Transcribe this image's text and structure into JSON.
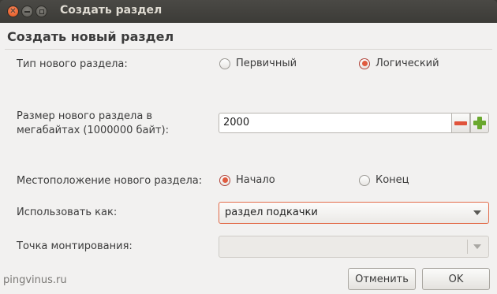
{
  "window": {
    "title": "Создать раздел",
    "close_icon": "close-icon",
    "minimize_icon": "minimize-icon",
    "maximize_icon": "maximize-icon"
  },
  "dialog": {
    "heading": "Создать новый раздел",
    "partition_type": {
      "label": "Тип нового раздела:",
      "options": [
        {
          "label": "Первичный",
          "selected": false
        },
        {
          "label": "Логический",
          "selected": true
        }
      ]
    },
    "size": {
      "label_line1": "Размер нового раздела в",
      "label_line2": "мегабайтах (1000000 байт):",
      "value": "2000",
      "decrement_icon": "minus-icon",
      "increment_icon": "plus-icon"
    },
    "location": {
      "label": "Местоположение нового раздела:",
      "options": [
        {
          "label": "Начало",
          "selected": true
        },
        {
          "label": "Конец",
          "selected": false
        }
      ]
    },
    "use_as": {
      "label": "Использовать как:",
      "value": "раздел подкачки"
    },
    "mount_point": {
      "label": "Точка монтирования:",
      "value": ""
    },
    "buttons": {
      "cancel": "Отменить",
      "ok": "OK"
    },
    "watermark": "pingvinus.ru"
  },
  "colors": {
    "accent": "#e05b3f",
    "titlebar": "#3c3b37",
    "dialog_bg": "#f2f1f0",
    "plus_green": "#6aa82e"
  }
}
